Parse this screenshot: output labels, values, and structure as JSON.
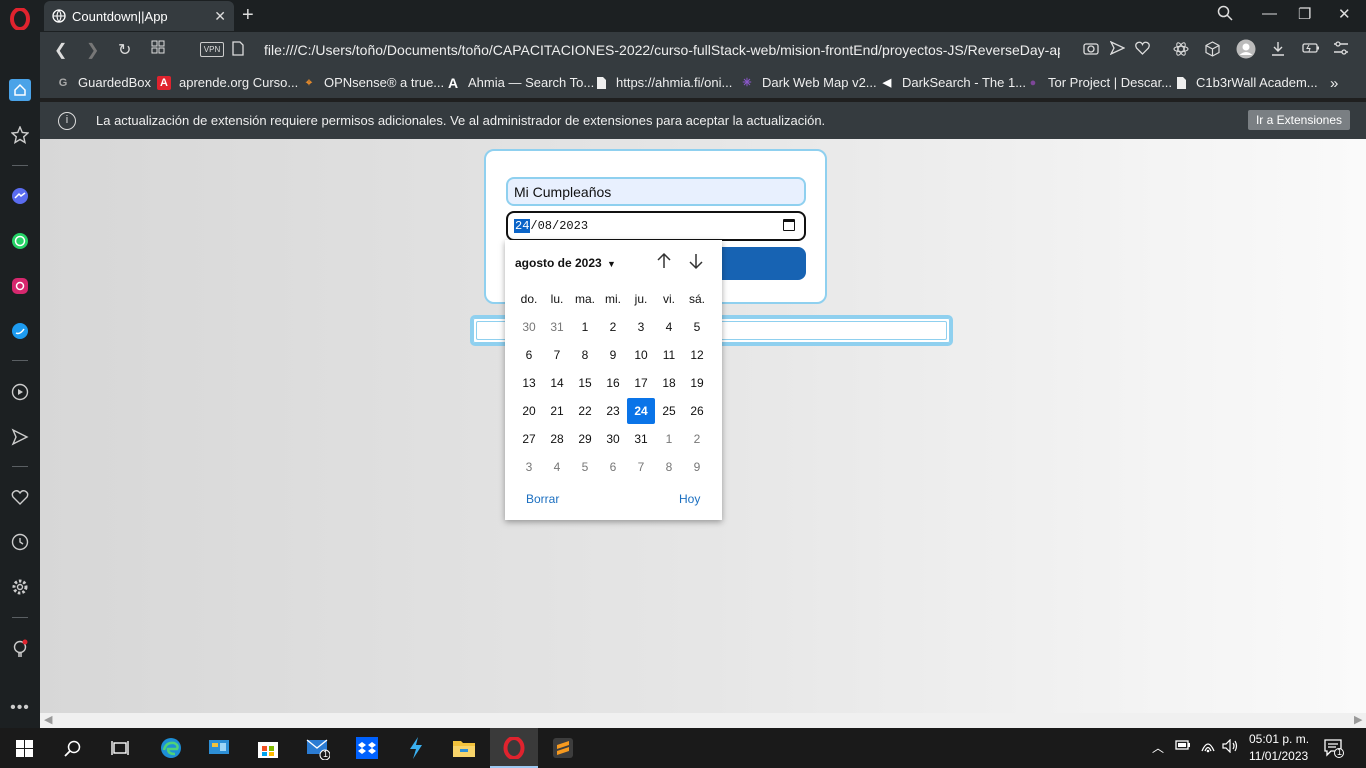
{
  "browser": {
    "tab_title": "Countdown||App",
    "url": "file:///C:/Users/toño/Documents/toño/CAPACITACIONES-2022/curso-fullStack-web/mision-frontEnd/proyectos-JS/ReverseDay-app/src/inde",
    "vpn_label": "VPN"
  },
  "bookmarks": [
    {
      "label": "GuardedBox",
      "icon": "guardedbox-icon"
    },
    {
      "label": "aprende.org Curso...",
      "icon": "aprende-icon"
    },
    {
      "label": "OPNsense® a true...",
      "icon": "opnsense-icon"
    },
    {
      "label": "Ahmia — Search To...",
      "icon": "ahmia-icon"
    },
    {
      "label": "https://ahmia.fi/oni...",
      "icon": "page-icon"
    },
    {
      "label": "Dark Web Map v2...",
      "icon": "darkwebmap-icon"
    },
    {
      "label": "DarkSearch - The 1...",
      "icon": "darksearch-icon"
    },
    {
      "label": "Tor Project | Descar...",
      "icon": "tor-icon"
    },
    {
      "label": "C1b3rWall Academ...",
      "icon": "page-icon"
    }
  ],
  "infobar": {
    "message": "La actualización de extensión requiere permisos adicionales. Ve al administrador de extensiones para aceptar la actualización.",
    "button": "Ir a Extensiones"
  },
  "form": {
    "name_value": "Mi Cumpleaños",
    "date_day": "24",
    "date_month": "08",
    "date_year": "2023",
    "date_sep": "/"
  },
  "picker": {
    "month_label": "agosto de 2023",
    "weekdays": [
      "do.",
      "lu.",
      "ma.",
      "mi.",
      "ju.",
      "vi.",
      "sá."
    ],
    "weeks": [
      [
        {
          "d": "30",
          "o": true
        },
        {
          "d": "31",
          "o": true
        },
        {
          "d": "1"
        },
        {
          "d": "2"
        },
        {
          "d": "3"
        },
        {
          "d": "4"
        },
        {
          "d": "5"
        }
      ],
      [
        {
          "d": "6"
        },
        {
          "d": "7"
        },
        {
          "d": "8"
        },
        {
          "d": "9"
        },
        {
          "d": "10"
        },
        {
          "d": "11"
        },
        {
          "d": "12"
        }
      ],
      [
        {
          "d": "13"
        },
        {
          "d": "14"
        },
        {
          "d": "15"
        },
        {
          "d": "16"
        },
        {
          "d": "17"
        },
        {
          "d": "18"
        },
        {
          "d": "19"
        }
      ],
      [
        {
          "d": "20"
        },
        {
          "d": "21"
        },
        {
          "d": "22"
        },
        {
          "d": "23"
        },
        {
          "d": "24",
          "s": true
        },
        {
          "d": "25"
        },
        {
          "d": "26"
        }
      ],
      [
        {
          "d": "27"
        },
        {
          "d": "28"
        },
        {
          "d": "29"
        },
        {
          "d": "30"
        },
        {
          "d": "31"
        },
        {
          "d": "1",
          "o": true
        },
        {
          "d": "2",
          "o": true
        }
      ],
      [
        {
          "d": "3",
          "o": true
        },
        {
          "d": "4",
          "o": true
        },
        {
          "d": "5",
          "o": true
        },
        {
          "d": "6",
          "o": true
        },
        {
          "d": "7",
          "o": true
        },
        {
          "d": "8",
          "o": true
        },
        {
          "d": "9",
          "o": true
        }
      ]
    ],
    "clear_label": "Borrar",
    "today_label": "Hoy"
  },
  "taskbar": {
    "time": "05:01 p. m.",
    "date": "11/01/2023",
    "mail_badge": "1",
    "notif_badge": "1"
  },
  "colors": {
    "accent": "#0a74e8",
    "card_border": "#8fd0ef",
    "button": "#1763b3"
  }
}
